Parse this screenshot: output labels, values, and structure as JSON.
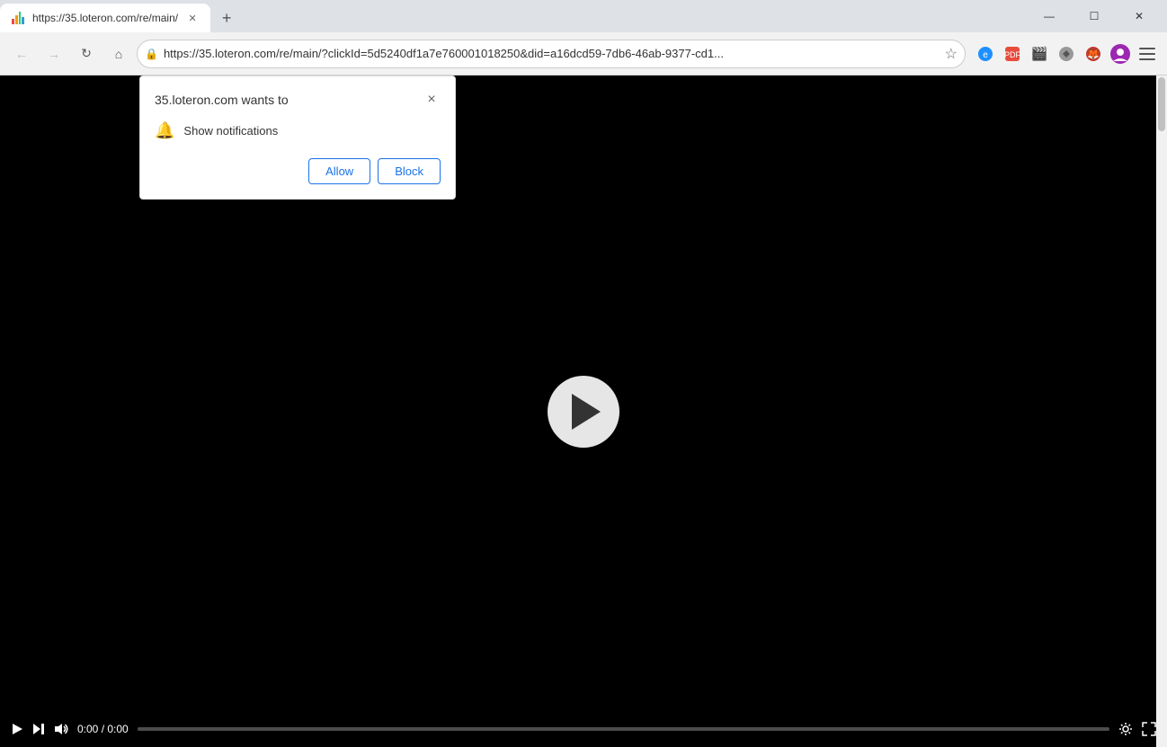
{
  "browser": {
    "tab": {
      "title": "https://35.loteron.com/re/main/",
      "favicon": "chart-icon"
    },
    "new_tab_label": "+",
    "window_controls": {
      "minimize": "—",
      "maximize": "☐",
      "close": "✕"
    },
    "toolbar": {
      "back": "←",
      "forward": "→",
      "refresh": "↺",
      "home": "⌂",
      "address": "https://35.loteron.com/re/main/?clickId=5d5240df1a7e760001018250&did=a16dcd59-7db6-46ab-9377-cd1...",
      "lock_icon": "🔒",
      "star_icon": "☆"
    }
  },
  "notification_popup": {
    "title": "35.loteron.com wants to",
    "close_label": "×",
    "permission_icon": "🔔",
    "permission_text": "Show notifications",
    "allow_label": "Allow",
    "block_label": "Block"
  },
  "video": {
    "play_label": "▶",
    "time_current": "0:00",
    "time_total": "0:00",
    "time_display": "0:00 / 0:00"
  }
}
